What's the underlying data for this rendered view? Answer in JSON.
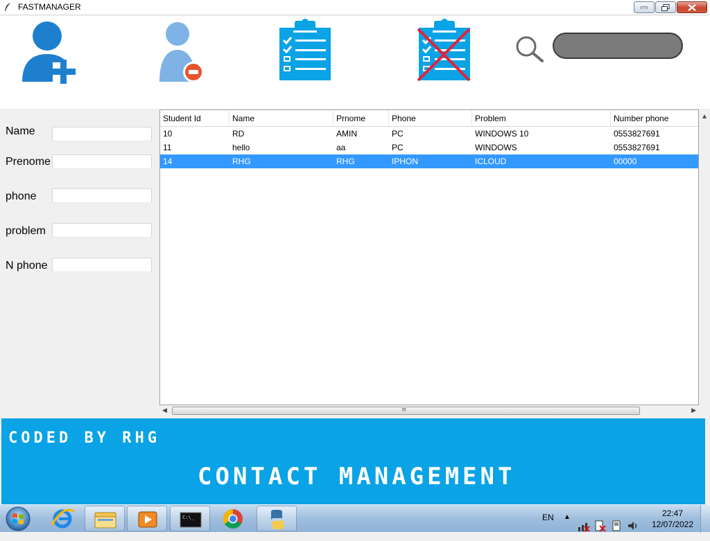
{
  "window": {
    "title": "FASTMANAGER"
  },
  "toolbar": {
    "add_user": "add-user",
    "remove_user": "remove-user",
    "list": "clipboard-list",
    "delete_list": "clipboard-delete",
    "search_placeholder": "",
    "search_value": ""
  },
  "form": {
    "name_label": "Name",
    "prenome_label": "Prenome",
    "phone_label": "phone",
    "problem_label": "problem",
    "nphone_label": "N phone",
    "name_value": "",
    "prenome_value": "",
    "phone_value": "",
    "problem_value": "",
    "nphone_value": ""
  },
  "table": {
    "headers": [
      "Student Id",
      "Name",
      "Prnome",
      "Phone",
      "Problem",
      "Number phone"
    ],
    "rows": [
      [
        "10",
        "RD",
        "AMIN",
        "PC",
        "WINDOWS 10",
        "0553827691"
      ],
      [
        "11",
        "hello",
        "aa",
        "PC",
        "WINDOWS",
        "0553827691"
      ],
      [
        "14",
        "RHG",
        "RHG",
        "IPHON",
        "ICLOUD",
        "00000"
      ]
    ],
    "selected_row": 2
  },
  "footer": {
    "coded_by": "CODED BY RHG",
    "app_name": "CONTACT MANAGEMENT"
  },
  "taskbar": {
    "lang": "EN",
    "time": "22:47",
    "date": "12/07/2022"
  },
  "colors": {
    "accent": "#0aa3e6",
    "selection": "#3399ff",
    "icon_blue": "#1f7fcf"
  }
}
